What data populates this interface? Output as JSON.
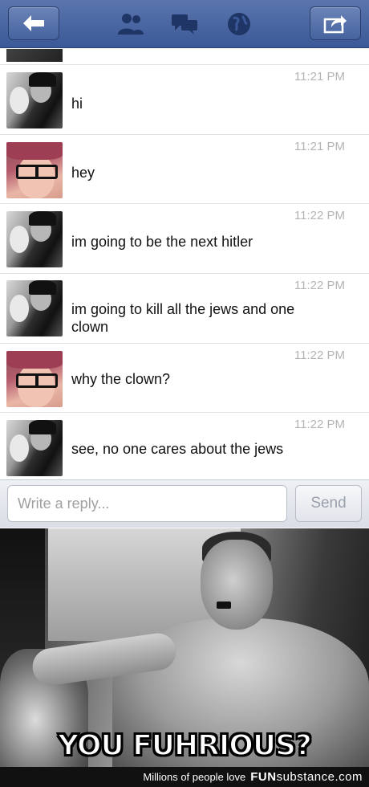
{
  "topbar": {
    "back_icon": "back-arrow-icon",
    "friends_icon": "friends-icon",
    "messages_icon": "messages-icon",
    "globe_icon": "globe-icon",
    "share_icon": "share-icon",
    "color": "#3b5998"
  },
  "messages": [
    {
      "sender": "user-bw",
      "time": "11:21 PM",
      "text": "hi"
    },
    {
      "sender": "user-red",
      "time": "11:21 PM",
      "text": "hey"
    },
    {
      "sender": "user-bw",
      "time": "11:22 PM",
      "text": "im going to be the next hitler"
    },
    {
      "sender": "user-bw",
      "time": "11:22 PM",
      "text": "im going to kill all the jews and one clown"
    },
    {
      "sender": "user-red",
      "time": "11:22 PM",
      "text": "why the clown?"
    },
    {
      "sender": "user-bw",
      "time": "11:22 PM",
      "text": "see, no one cares about the jews"
    }
  ],
  "reply": {
    "placeholder": "Write a reply...",
    "send_label": "Send"
  },
  "meme": {
    "caption": "YOU FUHRIOUS?"
  },
  "footer": {
    "tagline": "Millions of people love",
    "brand_part1": "FUN",
    "brand_part2": "substance",
    "brand_part3": ".com"
  }
}
